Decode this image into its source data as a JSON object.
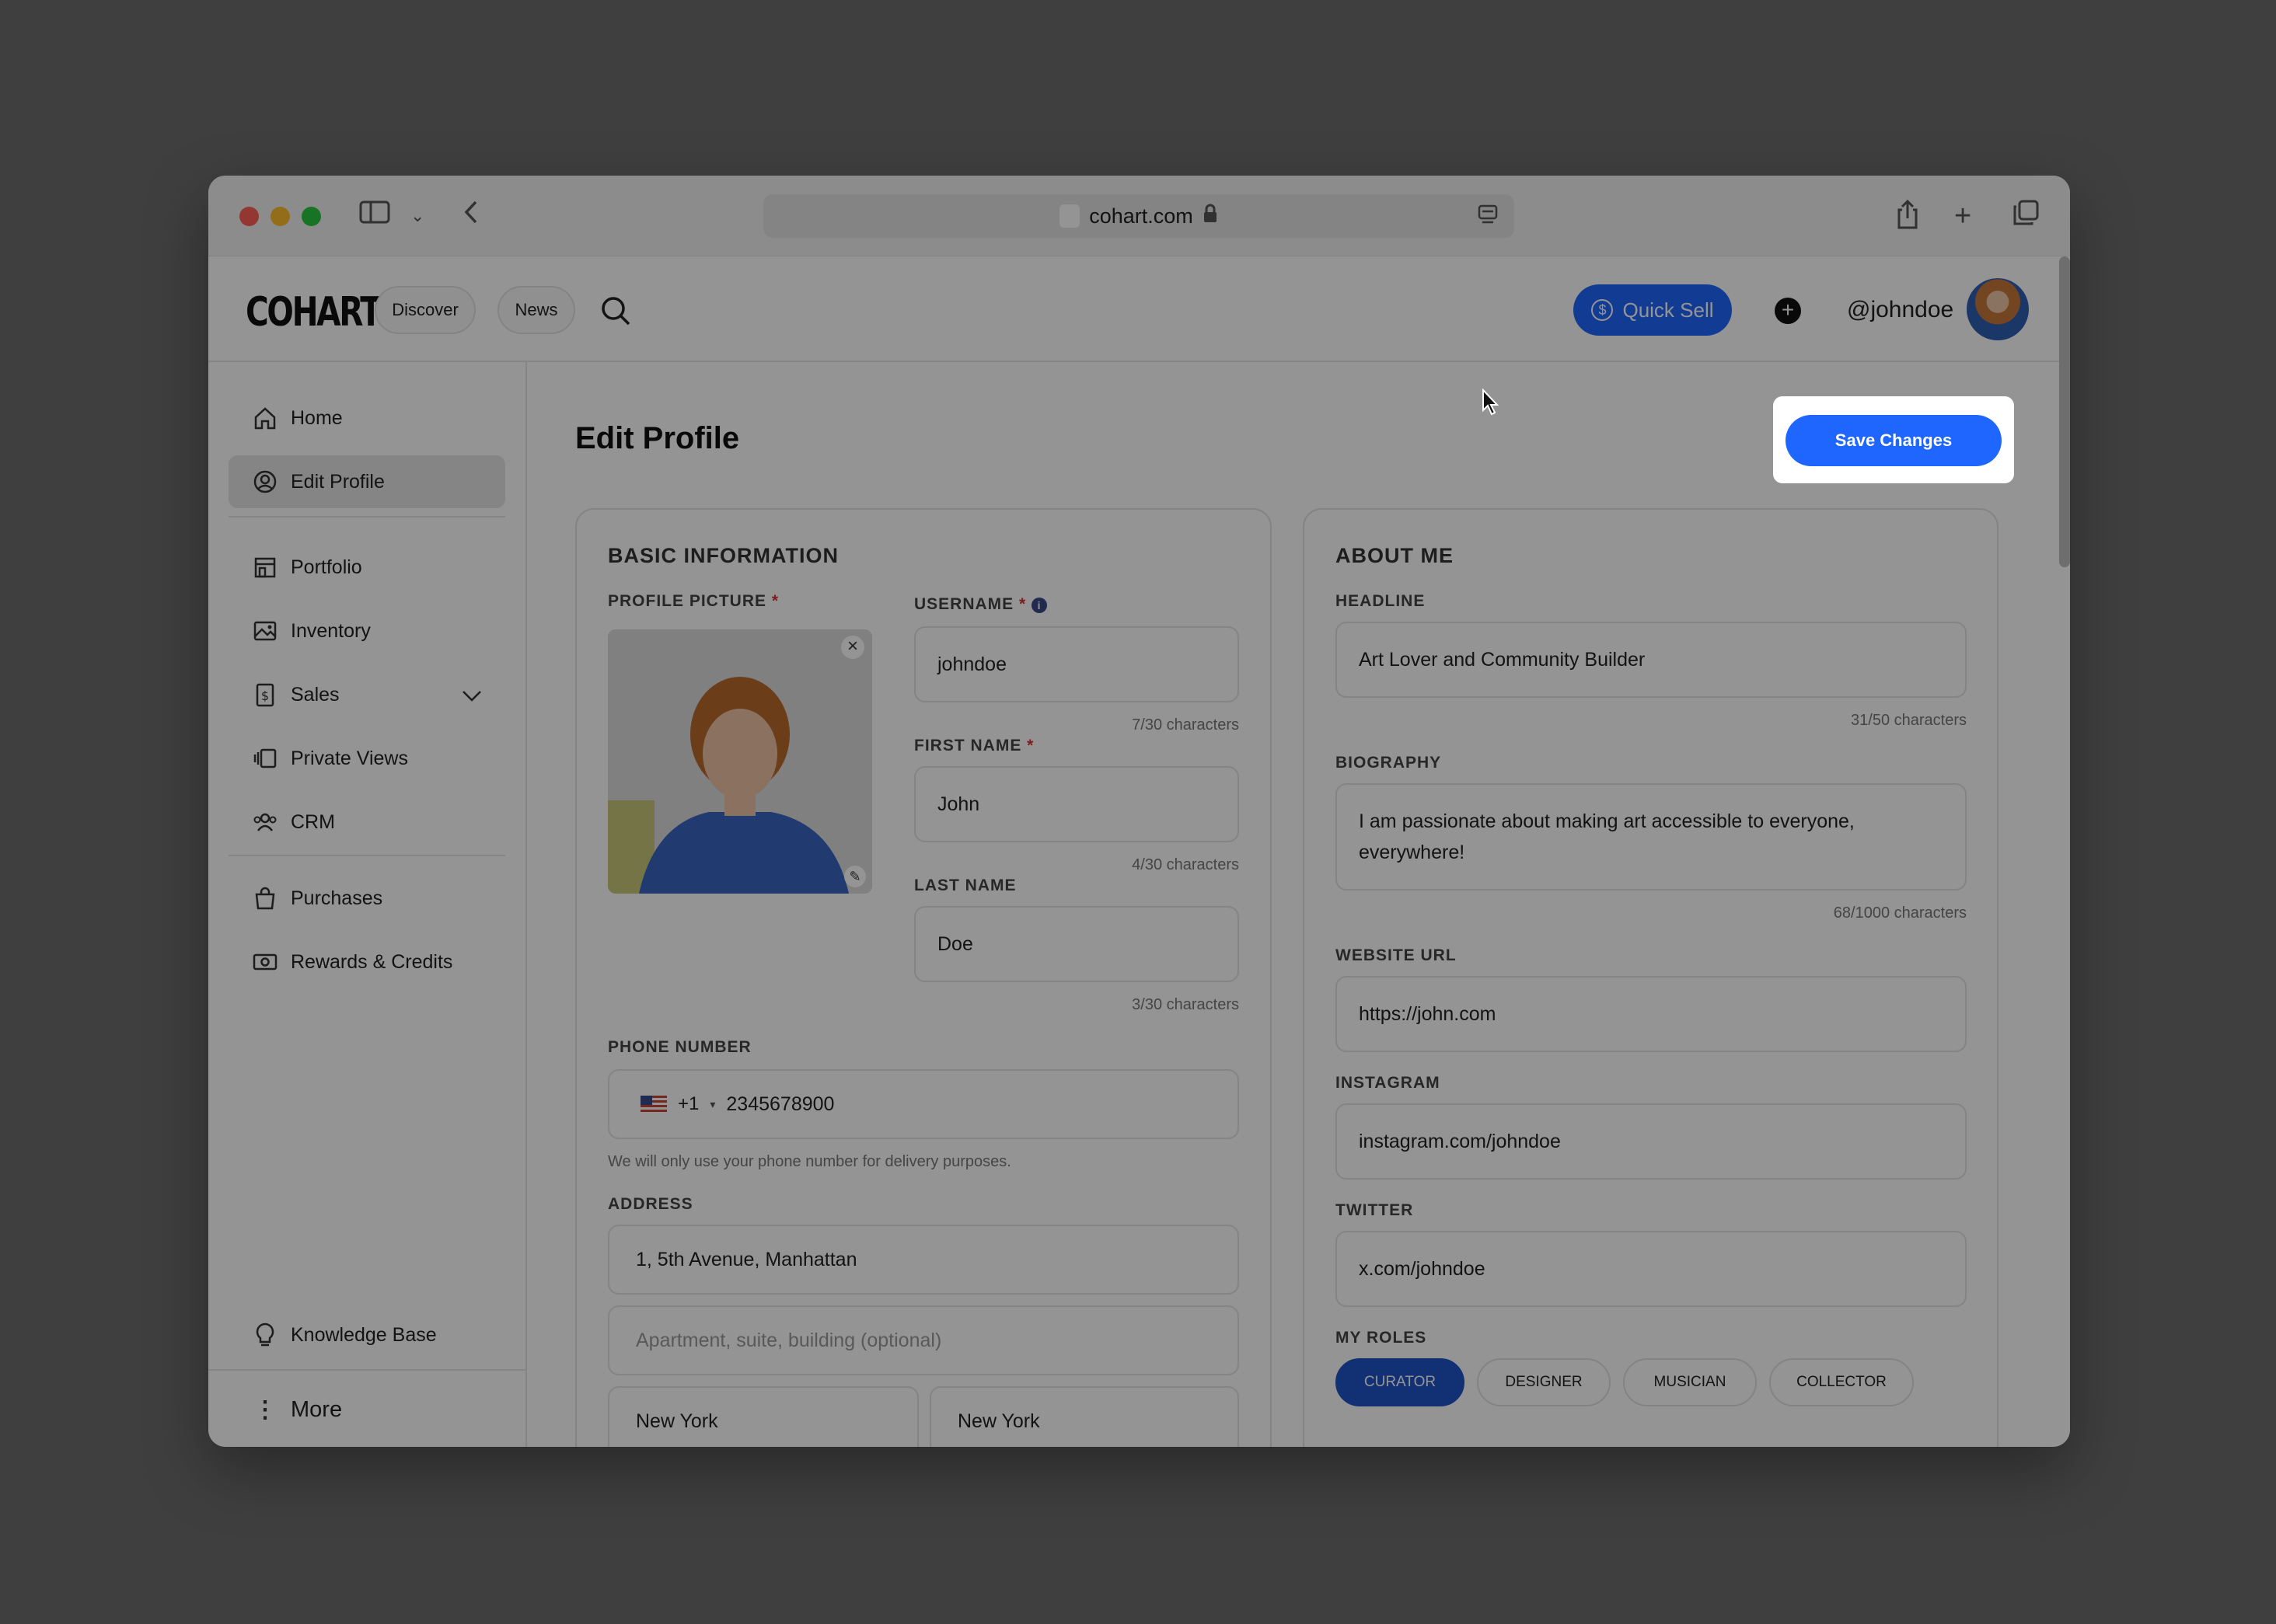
{
  "browser": {
    "url": "cohart.com"
  },
  "header": {
    "logo": "COHART",
    "nav": [
      "Discover",
      "News"
    ],
    "quick_sell": "Quick Sell",
    "username": "@johndoe"
  },
  "sidebar": {
    "items": [
      "Home",
      "Edit Profile",
      "Portfolio",
      "Inventory",
      "Sales",
      "Private Views",
      "CRM",
      "Purchases",
      "Rewards & Credits"
    ],
    "knowledge_base": "Knowledge Base",
    "more": "More"
  },
  "page": {
    "title": "Edit Profile",
    "save": "Save Changes"
  },
  "basic": {
    "section": "BASIC INFORMATION",
    "profile_picture": "PROFILE PICTURE",
    "username_label": "USERNAME",
    "username": "johndoe",
    "username_count": "7/30 characters",
    "first_label": "FIRST NAME",
    "first": "John",
    "first_count": "4/30 characters",
    "last_label": "LAST NAME",
    "last": "Doe",
    "last_count": "3/30 characters",
    "phone_label": "PHONE NUMBER",
    "country_code": "+1",
    "phone": "2345678900",
    "phone_hint": "We will only use your phone number for delivery purposes.",
    "address_label": "ADDRESS",
    "address1": "1, 5th Avenue, Manhattan",
    "address2_placeholder": "Apartment, suite, building (optional)",
    "city": "New York",
    "state": "New York"
  },
  "about": {
    "section": "ABOUT ME",
    "headline_label": "HEADLINE",
    "headline": "Art Lover and Community Builder",
    "headline_count": "31/50 characters",
    "bio_label": "BIOGRAPHY",
    "bio": "I am passionate about making art accessible to everyone, everywhere!",
    "bio_count": "68/1000 characters",
    "website_label": "WEBSITE URL",
    "website": "https://john.com",
    "instagram_label": "INSTAGRAM",
    "instagram": "instagram.com/johndoe",
    "twitter_label": "TWITTER",
    "twitter": "x.com/johndoe",
    "roles_label": "MY ROLES",
    "roles": [
      "CURATOR",
      "DESIGNER",
      "MUSICIAN",
      "COLLECTOR"
    ],
    "selected_role": "CURATOR"
  },
  "colors": {
    "accent": "#1f66ff",
    "role_selected": "#1f55c9",
    "required": "#d93232"
  }
}
